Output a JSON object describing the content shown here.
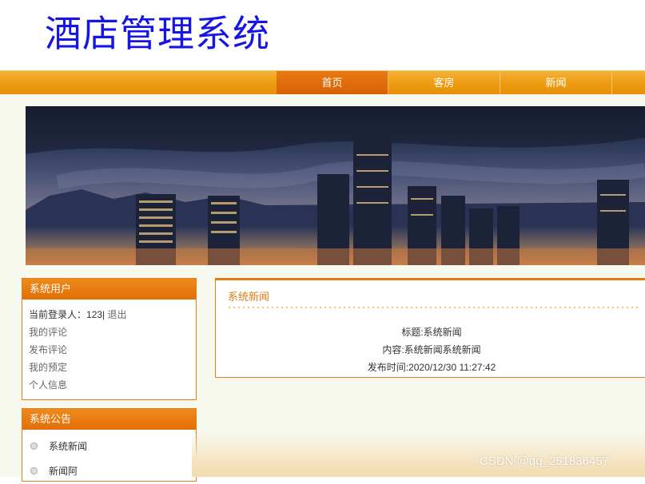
{
  "header": {
    "title": "酒店管理系统"
  },
  "nav": {
    "items": [
      "首页",
      "客房",
      "新闻"
    ],
    "active_index": 0
  },
  "sidebar": {
    "user_box": {
      "title": "系统用户",
      "login_label": "当前登录人：",
      "username": "123",
      "separator": "|",
      "logout": "退出",
      "links": [
        "我的评论",
        "发布评论",
        "我的预定",
        "个人信息"
      ]
    },
    "notice_box": {
      "title": "系统公告",
      "items": [
        "系统新闻",
        "新闻阿"
      ]
    }
  },
  "news": {
    "section_title": "系统新闻",
    "title_line": "标题:系统新闻",
    "content_line": "内容:系统新闻系统新闻",
    "time_line": "发布时间:2020/12/30 11:27:42"
  },
  "watermark": "CSDN @qq_251836457",
  "colors": {
    "accent": "#e57b14",
    "nav": "#ee9e14",
    "title": "#1515e6"
  }
}
